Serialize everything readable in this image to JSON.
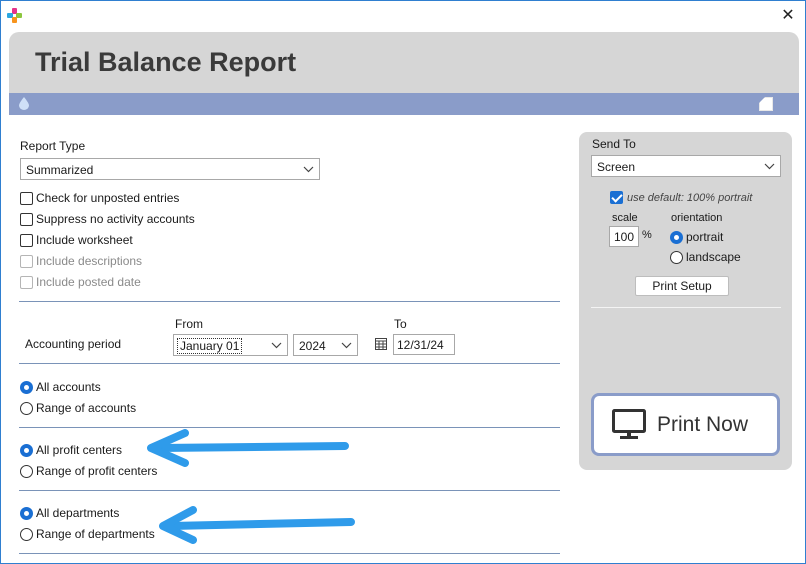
{
  "window": {
    "close_label": "✕"
  },
  "header": {
    "title": "Trial Balance Report"
  },
  "report_type": {
    "label": "Report Type",
    "selected": "Summarized"
  },
  "options": [
    {
      "label": "Check for unposted entries",
      "checked": false,
      "disabled": false
    },
    {
      "label": "Suppress no activity accounts",
      "checked": false,
      "disabled": false
    },
    {
      "label": "Include worksheet",
      "checked": false,
      "disabled": false
    },
    {
      "label": "Include descriptions",
      "checked": false,
      "disabled": true
    },
    {
      "label": "Include posted date",
      "checked": false,
      "disabled": true
    }
  ],
  "period": {
    "label": "Accounting period",
    "from_label": "From",
    "to_label": "To",
    "from_month": "January 01",
    "from_year": "2024",
    "to_date": "12/31/24"
  },
  "accounts": {
    "all_label": "All accounts",
    "range_label": "Range of accounts",
    "selected": "all"
  },
  "profit_centers": {
    "all_label": "All profit centers",
    "range_label": "Range of profit centers",
    "selected": "all"
  },
  "departments": {
    "all_label": "All departments",
    "range_label": "Range of departments",
    "selected": "all"
  },
  "send_to": {
    "label": "Send To",
    "selected": "Screen",
    "use_default_label": "use default: 100% portrait",
    "use_default_checked": true,
    "scale_label": "scale",
    "scale_value": "100",
    "scale_unit": "%",
    "orientation_label": "orientation",
    "portrait_label": "portrait",
    "landscape_label": "landscape",
    "orientation_selected": "portrait",
    "print_setup_label": "Print Setup",
    "print_now_label": "Print Now"
  },
  "colors": {
    "accent": "#1a6fd3",
    "header_bar": "#8a9cc9",
    "arrow": "#2f9bea"
  }
}
